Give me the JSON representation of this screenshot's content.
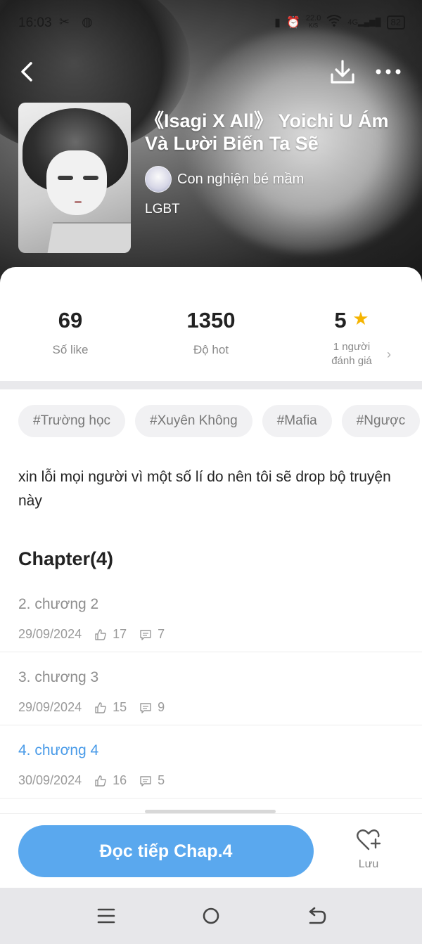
{
  "status_bar": {
    "time": "16:03",
    "net_speed_value": "22.0",
    "net_speed_unit": "K/S",
    "network": "4G",
    "battery": "82"
  },
  "book": {
    "title": "《Isagi X All》 Yoichi U Ám Và Lười Biến Ta Sẽ",
    "author": "Con nghiện bé mầm",
    "genre": "LGBT"
  },
  "stats": {
    "likes_value": "69",
    "likes_label": "Số like",
    "hot_value": "1350",
    "hot_label": "Độ hot",
    "rating_value": "5",
    "rating_label_line1": "1 người",
    "rating_label_line2": "đánh giá"
  },
  "tags": [
    "#Trường học",
    "#Xuyên Không",
    "#Mafia",
    "#Ngược"
  ],
  "description": "xin lỗi mọi người vì một số lí do nên tôi sẽ drop bộ truyện này",
  "chapters_heading": "Chapter(4)",
  "chapters": [
    {
      "title": "2. chương 2",
      "date": "29/09/2024",
      "likes": "17",
      "comments": "7",
      "active": false
    },
    {
      "title": "3. chương 3",
      "date": "29/09/2024",
      "likes": "15",
      "comments": "9",
      "active": false
    },
    {
      "title": "4. chương 4",
      "date": "30/09/2024",
      "likes": "16",
      "comments": "5",
      "active": true
    }
  ],
  "bottom": {
    "read_button": "Đọc tiếp Chap.4",
    "save_label": "Lưu"
  },
  "colors": {
    "accent": "#5aa8ee",
    "active_chapter": "#4a9be8",
    "star": "#f5b400"
  }
}
